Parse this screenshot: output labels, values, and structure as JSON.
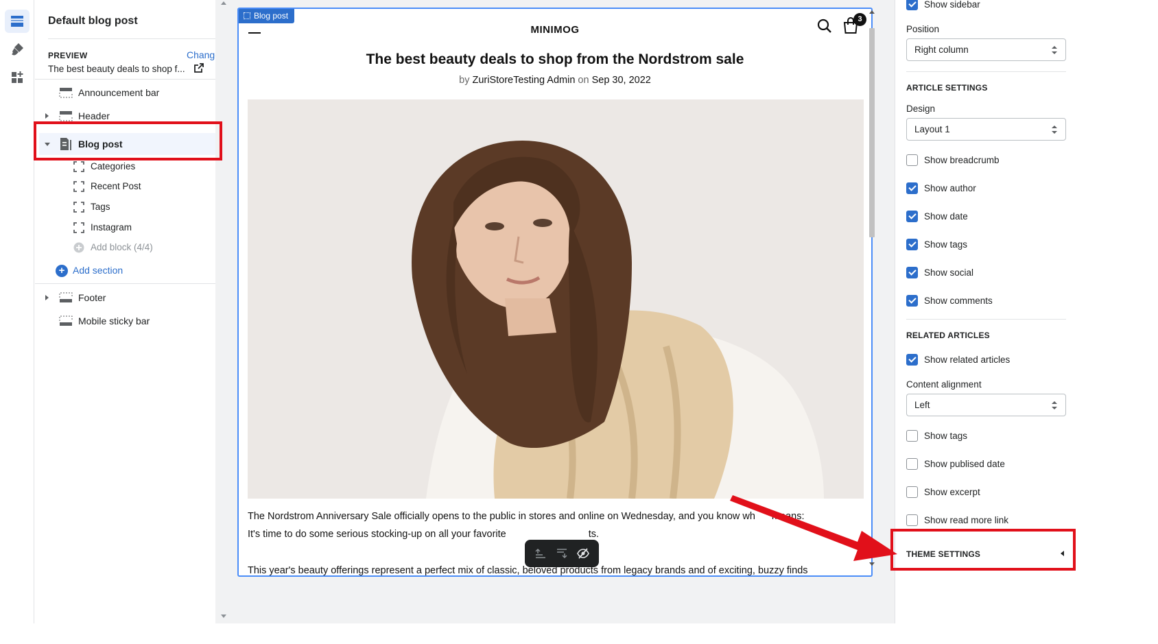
{
  "rail": {
    "items": [
      {
        "name": "sections",
        "icon": "sections-icon",
        "active": true
      },
      {
        "name": "theme-settings",
        "icon": "brush-icon",
        "active": false
      },
      {
        "name": "apps",
        "icon": "apps-icon",
        "active": false
      }
    ]
  },
  "sections_panel": {
    "page_title": "Default blog post",
    "preview_label": "PREVIEW",
    "change_label": "Change",
    "preview_value": "The best beauty deals to shop f...",
    "sections": [
      {
        "label": "Announcement bar",
        "icon": "announcement-icon",
        "expandable": false
      },
      {
        "label": "Header",
        "icon": "header-icon",
        "expandable": true,
        "expanded": false
      },
      {
        "label": "Blog post",
        "icon": "blog-post-icon",
        "expandable": true,
        "expanded": true,
        "selected": true
      }
    ],
    "blocks": [
      {
        "label": "Categories",
        "icon": "block-icon"
      },
      {
        "label": "Recent Post",
        "icon": "block-icon"
      },
      {
        "label": "Tags",
        "icon": "block-icon"
      },
      {
        "label": "Instagram",
        "icon": "block-icon"
      }
    ],
    "add_block_label": "Add block (4/4)",
    "add_section_label": "Add section",
    "footer_sections": [
      {
        "label": "Footer",
        "icon": "footer-icon",
        "expandable": true
      },
      {
        "label": "Mobile sticky bar",
        "icon": "sticky-bar-icon",
        "expandable": false
      }
    ]
  },
  "preview": {
    "frame_tag": "Blog post",
    "logo": "MINIMOG",
    "cart_count": "3",
    "article_title": "The best beauty deals to shop from the Nordstrom sale",
    "byline_prefix": "by",
    "author": "ZuriStoreTesting Admin",
    "byline_on": "on",
    "date": "Sep 30, 2022",
    "paragraph_1a": "The Nordstrom Anniversary Sale officially opens to the public in stores and online on Wednesday, and you know wh",
    "paragraph_1b": "means:",
    "paragraph_2a": "It's time to do some serious stocking-up on all your favorite",
    "paragraph_2b": "ts.",
    "paragraph_3": "This year's beauty offerings represent a perfect mix of classic, beloved products from legacy brands and of exciting, buzzy finds"
  },
  "settings_panel": {
    "show_sidebar": {
      "label": "Show sidebar",
      "checked": true
    },
    "position_label": "Position",
    "position_value": "Right column",
    "article_settings_heading": "ARTICLE SETTINGS",
    "design_label": "Design",
    "design_value": "Layout 1",
    "article_checks": [
      {
        "label": "Show breadcrumb",
        "checked": false
      },
      {
        "label": "Show author",
        "checked": true
      },
      {
        "label": "Show date",
        "checked": true
      },
      {
        "label": "Show tags",
        "checked": true
      },
      {
        "label": "Show social",
        "checked": true
      },
      {
        "label": "Show comments",
        "checked": true
      }
    ],
    "related_heading": "RELATED ARTICLES",
    "show_related": {
      "label": "Show related articles",
      "checked": true
    },
    "alignment_label": "Content alignment",
    "alignment_value": "Left",
    "related_checks": [
      {
        "label": "Show tags",
        "checked": false
      },
      {
        "label": "Show publised date",
        "checked": false
      },
      {
        "label": "Show excerpt",
        "checked": false
      },
      {
        "label": "Show read more link",
        "checked": false
      }
    ],
    "theme_settings_label": "THEME SETTINGS"
  },
  "colors": {
    "accent": "#2c6ecb",
    "annotation_red": "#e1101a",
    "frame_border": "#4b8df8"
  }
}
